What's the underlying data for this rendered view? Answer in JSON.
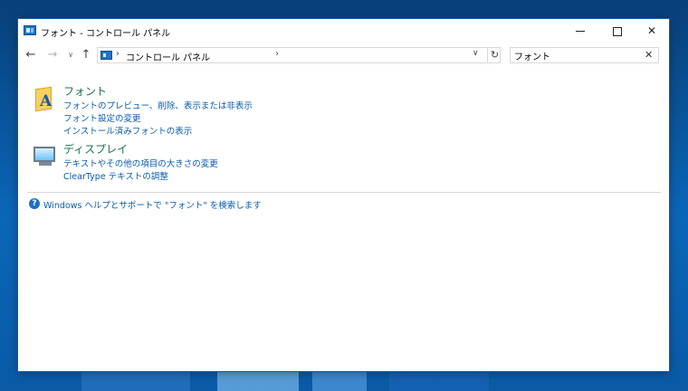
{
  "window": {
    "title": "フォント - コントロール パネル",
    "controls": {
      "minimize_icon": "minimize-icon",
      "maximize_icon": "maximize-icon",
      "close_icon": "close-icon",
      "close_glyph": "✕"
    }
  },
  "navigation": {
    "back_glyph": "←",
    "forward_glyph": "→",
    "recent_glyph": "∨",
    "up_glyph": "↑",
    "address": {
      "separator": "›",
      "crumbs": [
        "コントロール パネル"
      ],
      "dropdown_glyph": "∨",
      "refresh_glyph": "↻"
    },
    "search": {
      "value": "フォント",
      "placeholder": "",
      "clear_glyph": "✕"
    }
  },
  "groups": [
    {
      "title": "フォント",
      "icon": "fonts-folder-icon",
      "icon_letter": "A",
      "links": [
        "フォントのプレビュー、削除、表示または非表示",
        "フォント設定の変更",
        "インストール済みフォントの表示"
      ]
    },
    {
      "title": "ディスプレイ",
      "icon": "display-monitor-icon",
      "links": [
        "テキストやその他の項目の大きさの変更",
        "ClearType テキストの調整"
      ]
    }
  ],
  "help": {
    "icon_glyph": "?",
    "text": "Windows ヘルプとサポートで \"フォント\" を検索します"
  },
  "colors": {
    "title_green": "#1e7145",
    "link_blue": "#0b5cad",
    "desktop_blue": "#0b66b8"
  }
}
